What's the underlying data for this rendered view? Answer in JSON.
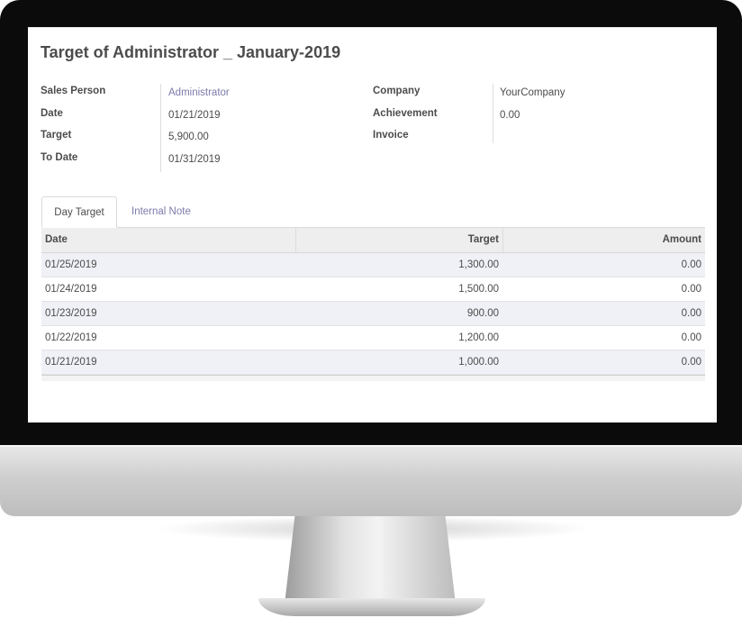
{
  "form": {
    "title": "Target of Administrator _ January-2019",
    "left_fields": [
      {
        "label": "Sales Person",
        "value": "Administrator"
      },
      {
        "label": "Date",
        "value": "01/21/2019"
      },
      {
        "label": "Target",
        "value": "5,900.00"
      },
      {
        "label": "To Date",
        "value": "01/31/2019"
      }
    ],
    "right_fields": [
      {
        "label": "Company",
        "value": "YourCompany"
      },
      {
        "label": "Achievement",
        "value": "0.00"
      },
      {
        "label": "Invoice",
        "value": ""
      }
    ]
  },
  "tabs": [
    {
      "label": "Day Target",
      "active": true
    },
    {
      "label": "Internal Note",
      "active": false
    }
  ],
  "table": {
    "columns": [
      "Date",
      "Target",
      "Amount"
    ],
    "rows": [
      {
        "date": "01/25/2019",
        "target": "1,300.00",
        "amount": "0.00"
      },
      {
        "date": "01/24/2019",
        "target": "1,500.00",
        "amount": "0.00"
      },
      {
        "date": "01/23/2019",
        "target": "900.00",
        "amount": "0.00"
      },
      {
        "date": "01/22/2019",
        "target": "1,200.00",
        "amount": "0.00"
      },
      {
        "date": "01/21/2019",
        "target": "1,000.00",
        "amount": "0.00"
      }
    ]
  },
  "colors": {
    "link": "#7c7bad",
    "text": "#4c4c4c",
    "row_alt": "#f0f0f7",
    "header_bg": "#eeeeee"
  }
}
